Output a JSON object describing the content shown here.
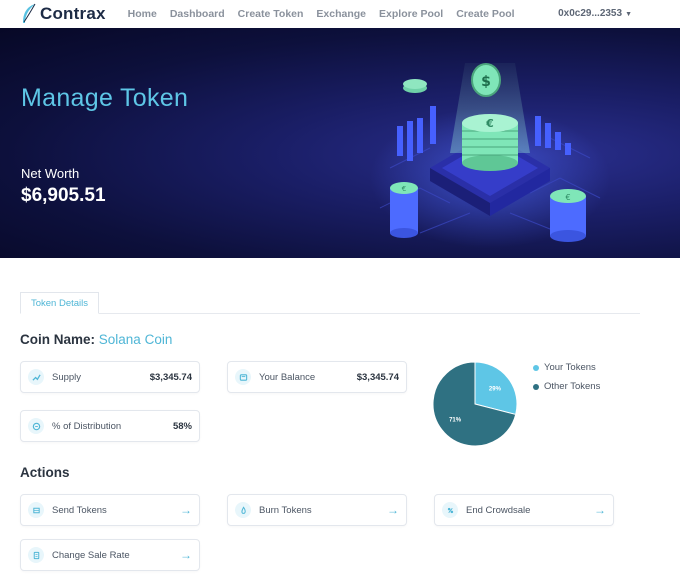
{
  "brand": {
    "name": "Contrax"
  },
  "nav": {
    "links": [
      "Home",
      "Dashboard",
      "Create Token",
      "Exchange",
      "Explore Pool",
      "Create Pool"
    ],
    "wallet": "0x0c29...2353"
  },
  "hero": {
    "title": "Manage Token",
    "net_worth_label": "Net Worth",
    "net_worth_value": "$6,905.51"
  },
  "tabs": [
    {
      "label": "Token Details"
    }
  ],
  "coin": {
    "label": "Coin Name:",
    "value": "Solana Coin"
  },
  "stats": {
    "supply": {
      "label": "Supply",
      "value": "$3,345.74",
      "icon": "trend-up-icon"
    },
    "balance": {
      "label": "Your Balance",
      "value": "$3,345.74",
      "icon": "wallet-icon"
    },
    "distribution": {
      "label": "% of Distribution",
      "value": "58%",
      "icon": "coin-icon"
    }
  },
  "chart_data": {
    "type": "pie",
    "slices": [
      {
        "label": "Your Tokens",
        "value": 29,
        "display": "29%",
        "color": "#5ec6e6"
      },
      {
        "label": "Other Tokens",
        "value": 71,
        "display": "71%",
        "color": "#2f7182"
      }
    ],
    "legend_position": "right"
  },
  "actions": {
    "title": "Actions",
    "items": [
      {
        "label": "Send Tokens",
        "icon": "send-icon"
      },
      {
        "label": "Burn Tokens",
        "icon": "burn-icon"
      },
      {
        "label": "End Crowdsale",
        "icon": "end-icon"
      },
      {
        "label": "Change Sale Rate",
        "icon": "rate-icon"
      }
    ]
  },
  "colors": {
    "accent": "#4fb6d6",
    "hero_bg": "#0d103c",
    "pie_dark": "#2f7182",
    "pie_light": "#5ec6e6"
  }
}
